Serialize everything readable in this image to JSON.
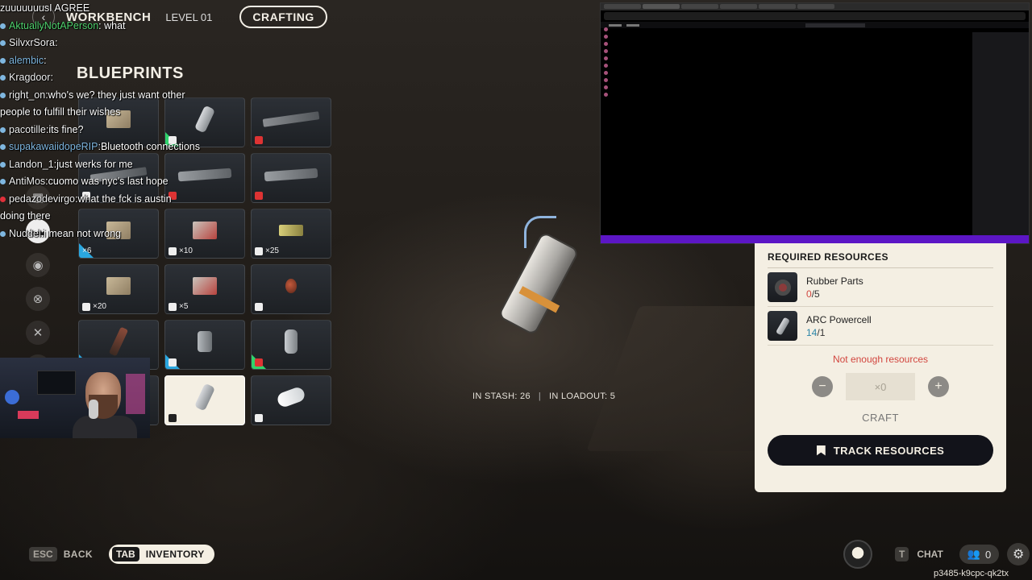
{
  "topbar": {
    "back_icon": "chevron-left-icon",
    "title": "WORKBENCH",
    "level": "LEVEL 01",
    "tab": "CRAFTING"
  },
  "blueprints": {
    "title": "BLUEPRINTS",
    "items": [
      {
        "id": 1,
        "art": "box",
        "badge": "",
        "rarity": "none"
      },
      {
        "id": 2,
        "art": "pc-small",
        "badge": "",
        "rarity": "green",
        "badge_icon": "shield-icon"
      },
      {
        "id": 3,
        "art": "gun",
        "badge": "",
        "rarity": "none",
        "badge_icon": "red-slash-icon"
      },
      {
        "id": 4,
        "art": "gun",
        "badge": "",
        "rarity": "none",
        "badge_icon": "ammo-icon"
      },
      {
        "id": 5,
        "art": "gun2",
        "badge": "",
        "rarity": "none",
        "badge_icon": "red-ammo-icon"
      },
      {
        "id": 6,
        "art": "gun2",
        "badge": "",
        "rarity": "none",
        "badge_icon": "red-ammo-icon"
      },
      {
        "id": 7,
        "art": "box",
        "badge": "×6",
        "rarity": "blue"
      },
      {
        "id": 8,
        "art": "box-red",
        "badge": "×10",
        "rarity": "none",
        "badge_icon": "slash-icon"
      },
      {
        "id": 9,
        "art": "ammo",
        "badge": "×25",
        "rarity": "none",
        "badge_icon": "ammo-icon"
      },
      {
        "id": 10,
        "art": "box",
        "badge": "×20",
        "rarity": "none",
        "badge_icon": "lines-icon"
      },
      {
        "id": 11,
        "art": "box-red",
        "badge": "×5",
        "rarity": "none",
        "badge_icon": "bars-icon"
      },
      {
        "id": 12,
        "art": "grenade",
        "badge": "",
        "rarity": "none",
        "badge_icon": "bomb-icon"
      },
      {
        "id": 13,
        "art": "blade",
        "badge": "",
        "rarity": "blue"
      },
      {
        "id": 14,
        "art": "can",
        "badge": "",
        "rarity": "blue",
        "badge_icon": "target-icon"
      },
      {
        "id": 15,
        "art": "tube",
        "badge": "",
        "rarity": "green",
        "badge_icon": "red-target-icon"
      },
      {
        "id": 16,
        "art": "bandage-dark",
        "badge": "",
        "rarity": "none"
      },
      {
        "id": 17,
        "art": "pc-small",
        "badge": "",
        "rarity": "none",
        "selected": true,
        "badge_icon": "red-cross-icon"
      },
      {
        "id": 18,
        "art": "bandage",
        "badge": "",
        "rarity": "none",
        "badge_icon": "cross-icon"
      }
    ]
  },
  "stash": {
    "in_stash_label": "IN STASH:",
    "in_stash": "26",
    "in_loadout_label": "IN LOADOUT:",
    "in_loadout": "5"
  },
  "panel": {
    "heading": "REQUIRED RESOURCES",
    "resources": [
      {
        "name": "Rubber Parts",
        "have": "0",
        "need": "/5",
        "status": "short"
      },
      {
        "name": "ARC Powercell",
        "have": "14",
        "need": "/1",
        "status": "ok"
      }
    ],
    "warning": "Not enough resources",
    "minus": "−",
    "quantity": "×0",
    "plus": "+",
    "craft_label": "CRAFT",
    "track_label": "TRACK RESOURCES"
  },
  "chat": [
    {
      "user": "zuuuuuuus",
      "msg": "I AGREE",
      "color": "white",
      "dot": "none"
    },
    {
      "user": "AktuallyNotAPerson",
      "msg": ": what",
      "color": "green",
      "dot": "blue"
    },
    {
      "user": "SilvxrSora",
      "msg": ":",
      "color": "white",
      "dot": "blue"
    },
    {
      "user": "alembic",
      "msg": ":",
      "color": "blue",
      "dot": "blue"
    },
    {
      "user": "Kragdoor",
      "msg": ":",
      "color": "white",
      "dot": "blue"
    },
    {
      "user": "right_on",
      "msg": ":who's we? they just want other people to fulfill their wishes",
      "color": "white",
      "dot": "blue"
    },
    {
      "user": "pacotille",
      "msg": ":its fine?",
      "color": "white",
      "dot": "blue"
    },
    {
      "user": "supakawaiidopeRIP",
      "msg": ":Bluetooth connections",
      "color": "blue",
      "dot": "blue"
    },
    {
      "user": "Landon_1",
      "msg": ":just werks for me",
      "color": "white",
      "dot": "blue"
    },
    {
      "user": "AntiMos",
      "msg": ":cuomo was nyc's last hope",
      "color": "white",
      "dot": "blue"
    },
    {
      "user": "pedazodevirgo",
      "msg": ":what the fck is austin doing there",
      "color": "white",
      "dot": "red"
    },
    {
      "user": "Nuddel",
      "msg": ":i mean not wrong",
      "color": "white",
      "dot": "blue"
    }
  ],
  "bottom": {
    "esc_key": "ESC",
    "back_label": "BACK",
    "tab_key": "TAB",
    "inventory_label": "INVENTORY",
    "t_key": "T",
    "chat_label": "CHAT",
    "friends_count": "0",
    "session_id": "p3485-k9cpc-qk2tx"
  },
  "colors": {
    "panel_bg": "#f4efe3",
    "accent_red": "#d2463f",
    "accent_teal": "#2c86a8",
    "rarity_green": "#2fd36b",
    "rarity_blue": "#2aa7e0"
  }
}
